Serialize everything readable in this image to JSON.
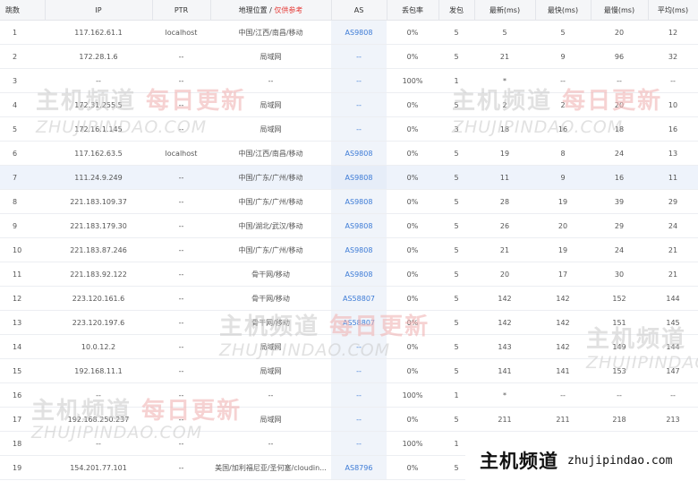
{
  "table": {
    "headers": {
      "hop": "跳数",
      "ip": "IP",
      "ptr": "PTR",
      "location": "地理位置 /",
      "location_note": "仅供参考",
      "as": "AS",
      "loss": "丢包率",
      "sent": "发包",
      "last": "最新(ms)",
      "best": "最快(ms)",
      "worst": "最慢(ms)",
      "avg": "平均(ms)"
    },
    "rows": [
      {
        "hop": "1",
        "ip": "117.162.61.1",
        "ptr": "localhost",
        "location": "中国/江西/南昌/移动",
        "as": "AS9808",
        "loss": "0%",
        "sent": "5",
        "last": "5",
        "best": "5",
        "worst": "20",
        "avg": "12"
      },
      {
        "hop": "2",
        "ip": "172.28.1.6",
        "ptr": "--",
        "location": "局域网",
        "as": "--",
        "loss": "0%",
        "sent": "5",
        "last": "21",
        "best": "9",
        "worst": "96",
        "avg": "32"
      },
      {
        "hop": "3",
        "ip": "--",
        "ptr": "--",
        "location": "--",
        "as": "--",
        "loss": "100%",
        "sent": "1",
        "last": "*",
        "best": "--",
        "worst": "--",
        "avg": "--"
      },
      {
        "hop": "4",
        "ip": "172.31.255.5",
        "ptr": "--",
        "location": "局域网",
        "as": "--",
        "loss": "0%",
        "sent": "5",
        "last": "2",
        "best": "2",
        "worst": "20",
        "avg": "10"
      },
      {
        "hop": "5",
        "ip": "172.16.1.145",
        "ptr": "--",
        "location": "局域网",
        "as": "--",
        "loss": "0%",
        "sent": "3",
        "last": "18",
        "best": "16",
        "worst": "18",
        "avg": "16"
      },
      {
        "hop": "6",
        "ip": "117.162.63.5",
        "ptr": "localhost",
        "location": "中国/江西/南昌/移动",
        "as": "AS9808",
        "loss": "0%",
        "sent": "5",
        "last": "19",
        "best": "8",
        "worst": "24",
        "avg": "13"
      },
      {
        "hop": "7",
        "ip": "111.24.9.249",
        "ptr": "--",
        "location": "中国/广东/广州/移动",
        "as": "AS9808",
        "loss": "0%",
        "sent": "5",
        "last": "11",
        "best": "9",
        "worst": "16",
        "avg": "11"
      },
      {
        "hop": "8",
        "ip": "221.183.109.37",
        "ptr": "--",
        "location": "中国/广东/广州/移动",
        "as": "AS9808",
        "loss": "0%",
        "sent": "5",
        "last": "28",
        "best": "19",
        "worst": "39",
        "avg": "29"
      },
      {
        "hop": "9",
        "ip": "221.183.179.30",
        "ptr": "--",
        "location": "中国/湖北/武汉/移动",
        "as": "AS9808",
        "loss": "0%",
        "sent": "5",
        "last": "26",
        "best": "20",
        "worst": "29",
        "avg": "24"
      },
      {
        "hop": "10",
        "ip": "221.183.87.246",
        "ptr": "--",
        "location": "中国/广东/广州/移动",
        "as": "AS9808",
        "loss": "0%",
        "sent": "5",
        "last": "21",
        "best": "19",
        "worst": "24",
        "avg": "21"
      },
      {
        "hop": "11",
        "ip": "221.183.92.122",
        "ptr": "--",
        "location": "骨干网/移动",
        "as": "AS9808",
        "loss": "0%",
        "sent": "5",
        "last": "20",
        "best": "17",
        "worst": "30",
        "avg": "21"
      },
      {
        "hop": "12",
        "ip": "223.120.161.6",
        "ptr": "--",
        "location": "骨干网/移动",
        "as": "AS58807",
        "loss": "0%",
        "sent": "5",
        "last": "142",
        "best": "142",
        "worst": "152",
        "avg": "144"
      },
      {
        "hop": "13",
        "ip": "223.120.197.6",
        "ptr": "--",
        "location": "骨干网/移动",
        "as": "AS58807",
        "loss": "0%",
        "sent": "5",
        "last": "142",
        "best": "142",
        "worst": "151",
        "avg": "145"
      },
      {
        "hop": "14",
        "ip": "10.0.12.2",
        "ptr": "--",
        "location": "局域网",
        "as": "--",
        "loss": "0%",
        "sent": "5",
        "last": "143",
        "best": "142",
        "worst": "149",
        "avg": "144"
      },
      {
        "hop": "15",
        "ip": "192.168.11.1",
        "ptr": "--",
        "location": "局域网",
        "as": "--",
        "loss": "0%",
        "sent": "5",
        "last": "141",
        "best": "141",
        "worst": "153",
        "avg": "147"
      },
      {
        "hop": "16",
        "ip": "--",
        "ptr": "--",
        "location": "--",
        "as": "--",
        "loss": "100%",
        "sent": "1",
        "last": "*",
        "best": "--",
        "worst": "--",
        "avg": "--"
      },
      {
        "hop": "17",
        "ip": "192.168.250.237",
        "ptr": "--",
        "location": "局域网",
        "as": "--",
        "loss": "0%",
        "sent": "5",
        "last": "211",
        "best": "211",
        "worst": "218",
        "avg": "213"
      },
      {
        "hop": "18",
        "ip": "--",
        "ptr": "--",
        "location": "--",
        "as": "--",
        "loss": "100%",
        "sent": "1",
        "last": "",
        "best": "",
        "worst": "",
        "avg": ""
      },
      {
        "hop": "19",
        "ip": "154.201.77.101",
        "ptr": "--",
        "location": "美国/加利福尼亚/圣何塞/cloudin...",
        "as": "AS8796",
        "loss": "0%",
        "sent": "5",
        "last": "",
        "best": "",
        "worst": "",
        "avg": ""
      }
    ]
  },
  "watermark": {
    "cn_main": "主机频道",
    "cn_sub": "每日更新",
    "en": "ZHUJIPINDAO.COM"
  },
  "brand": {
    "cn": "主机频道",
    "en": "zhujipindao.com"
  },
  "colors": {
    "header_bg": "#f5f6f8",
    "as_link": "#3d7bd6",
    "note_red": "#e53935",
    "highlight_row": "#eef3fb"
  }
}
